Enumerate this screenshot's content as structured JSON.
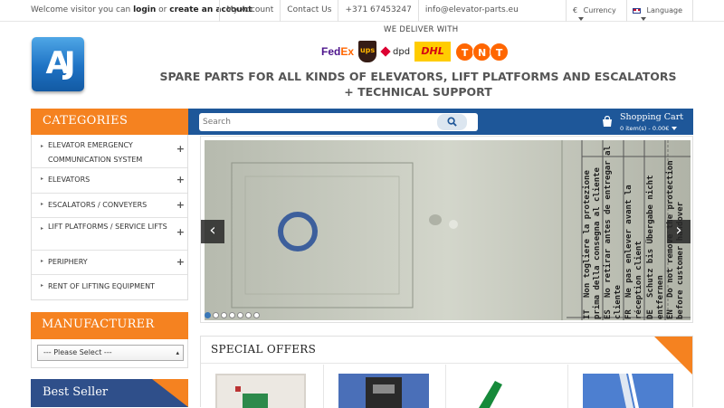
{
  "topbar": {
    "welcome_prefix": "Welcome visitor you can",
    "login": "login",
    "or": "or",
    "create_account": "create an account",
    "welcome_suffix": ".",
    "links": [
      "My Account",
      "Contact Us",
      "+371 67453247",
      "info@elevator-parts.eu"
    ],
    "currency_symbol": "€",
    "currency": "Currency",
    "language": "Language"
  },
  "header": {
    "logo_text": "AJ",
    "deliver_label": "WE DELIVER WITH",
    "carriers": [
      "FedEx",
      "UPS",
      "dpd",
      "DHL",
      "TNT"
    ],
    "tagline": "SPARE PARTS FOR ALL KINDS OF ELEVATORS, LIFT PLATFORMS AND ESCALATORS + TECHNICAL SUPPORT"
  },
  "categories": {
    "title": "CATEGORIES",
    "items": [
      {
        "label": "ELEVATOR EMERGENCY COMMUNICATION SYSTEM",
        "expandable": true
      },
      {
        "label": "ELEVATORS",
        "expandable": true
      },
      {
        "label": "ESCALATORS / CONVEYERS",
        "expandable": true
      },
      {
        "label": "LIFT PLATFORMS / SERVICE LIFTS",
        "expandable": true
      },
      {
        "label": "PERIPHERY",
        "expandable": true
      },
      {
        "label": "RENT OF LIFTING EQUIPMENT",
        "expandable": false
      }
    ],
    "expand_symbol": "+",
    "bullet": "▸"
  },
  "manufacturer": {
    "title": "MANUFACTURER",
    "selected": "--- Please Select ---"
  },
  "best_seller": {
    "title": "Best Seller"
  },
  "search": {
    "placeholder": "Search"
  },
  "cart": {
    "title": "Shopping Cart",
    "summary": "0 item(s) - 0.00€"
  },
  "slider": {
    "slide_count": 7,
    "active_index": 0,
    "prev": "‹",
    "next": "›",
    "label_rows": [
      {
        "code": "EN",
        "text": "Do not remove the protection before customer handover"
      },
      {
        "code": "DE",
        "text": "Schutz bis Übergabe nicht entfernen"
      },
      {
        "code": "FR",
        "text": "Ne pas enlever avant la réception client"
      },
      {
        "code": "ES",
        "text": "No retirar antes de entregar al cliente"
      },
      {
        "code": "IT",
        "text": "Non togliere la protezione prima della consegna al cliente"
      }
    ]
  },
  "special_offers": {
    "title": "SPECIAL OFFERS"
  },
  "colors": {
    "accent_orange": "#f58220",
    "brand_blue": "#1e5799",
    "best_seller_blue": "#2f4f8a"
  }
}
